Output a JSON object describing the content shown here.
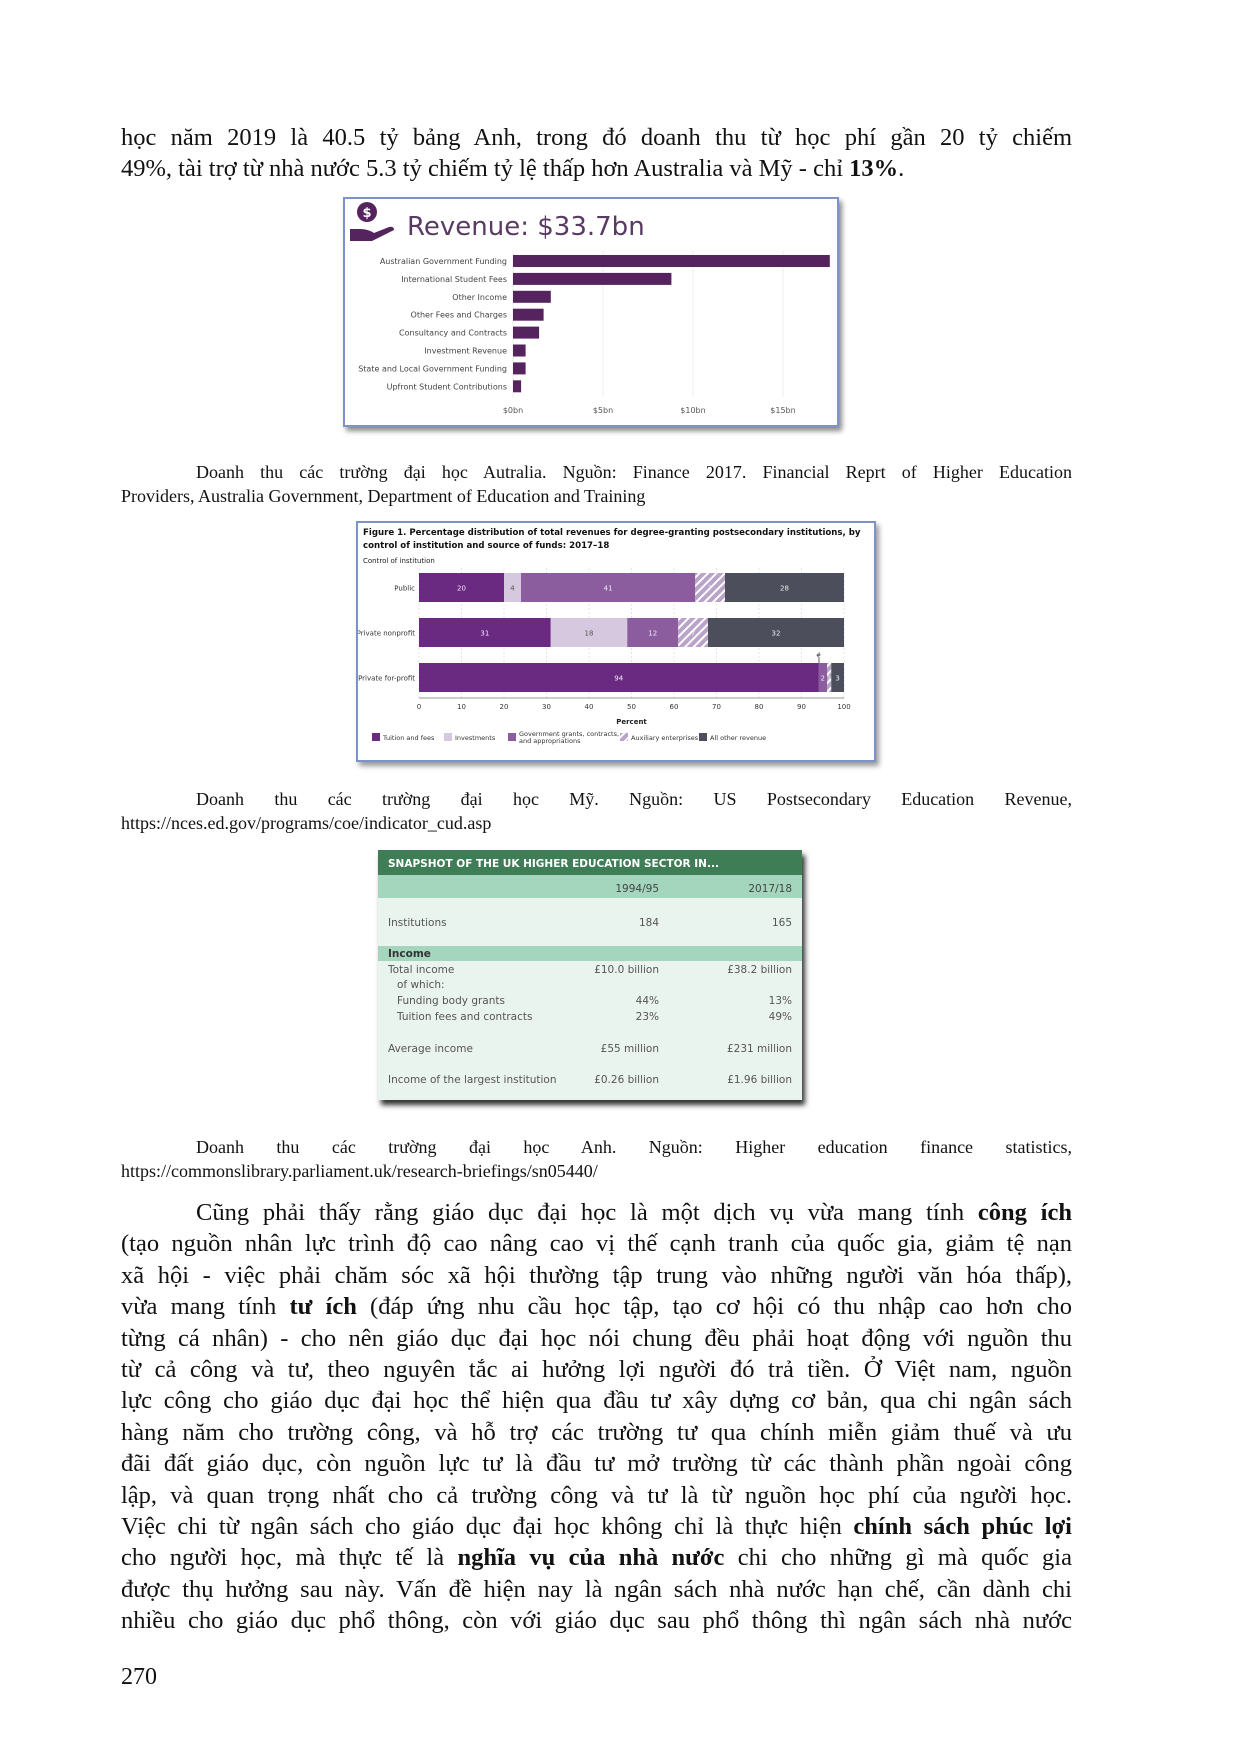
{
  "top_lines": [
    [
      {
        "t": "học năm 2019 là 40.5 tỷ bảng Anh, trong đó doanh thu từ học phí gần 20 tỷ chiếm"
      }
    ],
    [
      {
        "t": "49%, tài trợ từ nhà nước 5.3 tỷ chiếm tỷ lệ thấp hơn Australia và Mỹ - chỉ "
      },
      {
        "t": "13%",
        "b": true
      },
      {
        "t": "."
      }
    ]
  ],
  "figure1": {
    "icon": "hand-dollar-icon",
    "accent": "#55245e",
    "chart_data": {
      "type": "bar",
      "orientation": "horizontal",
      "title": "Revenue: $33.7bn",
      "categories": [
        "Australian Government Funding",
        "International Student Fees",
        "Other Income",
        "Other Fees and Charges",
        "Consultancy and Contracts",
        "Investment Revenue",
        "State and Local Government Funding",
        "Upfront Student Contributions"
      ],
      "values": [
        17.6,
        8.8,
        2.1,
        1.7,
        1.45,
        0.7,
        0.7,
        0.45
      ],
      "unit": "$bn",
      "xticks": [
        "$0bn",
        "$5bn",
        "$10bn",
        "$15bn"
      ],
      "xtick_values": [
        0,
        5,
        10,
        15
      ],
      "xlim": [
        0,
        17.8
      ],
      "grid": true
    }
  },
  "caption1": [
    "Doanh thu các trường đại học Autralia. Nguồn: Finance 2017. Financial Reprt of Higher Education",
    "Providers, Australia Government, Department of Education and Training"
  ],
  "figure2": {
    "chart_data": {
      "type": "bar",
      "stacked": true,
      "orientation": "horizontal",
      "title": "Figure 1. Percentage distribution of total revenues for degree-granting postsecondary institutions, by control of institution and source of funds: 2017–18",
      "title_lines": [
        "Figure 1. Percentage distribution of total revenues for degree-granting postsecondary institutions, by",
        "control of institution and source of funds: 2017–18"
      ],
      "ylabel": "Control of institution",
      "xlabel": "Percent",
      "categories": [
        "Public",
        "Private nonprofit",
        "Private for-profit"
      ],
      "series": [
        {
          "name": "Tuition and fees",
          "color": "#6a2a82",
          "values": [
            20,
            31,
            94
          ],
          "labels": [
            "20",
            "31",
            "94"
          ]
        },
        {
          "name": "Investments",
          "color": "#d5c8df",
          "values": [
            4,
            18,
            0
          ],
          "labels": [
            "4",
            "18",
            "#"
          ]
        },
        {
          "name": "Government grants, contracts, and appropriations",
          "color": "#8b5c9e",
          "values": [
            41,
            12,
            2
          ],
          "labels": [
            "41",
            "12",
            "2"
          ]
        },
        {
          "name": "Auxiliary enterprises",
          "color": "#b9a3c9",
          "hatched": true,
          "values": [
            7,
            7,
            1
          ],
          "labels": [
            "7",
            "7",
            "1"
          ]
        },
        {
          "name": "All other revenue",
          "color": "#4d4e5c",
          "values": [
            28,
            32,
            3
          ],
          "labels": [
            "28",
            "32",
            "3"
          ]
        }
      ],
      "legend": [
        "Tuition and fees",
        "Investments",
        "Government grants, contracts,|and appropriations",
        "Auxiliary enterprises",
        "All other revenue"
      ],
      "xticks": [
        "0",
        "10",
        "20",
        "30",
        "40",
        "50",
        "60",
        "70",
        "80",
        "90",
        "100"
      ],
      "xlim": [
        0,
        100
      ],
      "grid": true,
      "legend_placement": "bottom"
    }
  },
  "caption2": [
    "Doanh thu các trường đại học Mỹ. Nguồn: US Postsecondary Education Revenue,",
    "https://nces.ed.gov/programs/coe/indicator_cud.asp"
  ],
  "table": {
    "title": "SNAPSHOT OF THE UK HIGHER EDUCATION SECTOR IN...",
    "header_color": "#3f7d57",
    "subheader_color": "#a3d6bd",
    "columns": [
      "1994/95",
      "2017/18"
    ],
    "section": "Income",
    "rows": [
      {
        "label": "Institutions",
        "v1": "184",
        "v2": "165"
      },
      {
        "label": "Total income",
        "v1": "£10.0 billion",
        "v2": "£38.2 billion"
      },
      {
        "label": "of which:",
        "v1": "",
        "v2": ""
      },
      {
        "label": "Funding body grants",
        "v1": "44%",
        "v2": "13%"
      },
      {
        "label": "Tuition fees and contracts",
        "v1": "23%",
        "v2": "49%"
      },
      {
        "label": "Average income",
        "v1": "£55 million",
        "v2": "£231 million"
      },
      {
        "label": "Income of the largest institution",
        "v1": "£0.26 billion",
        "v2": "£1.96 billion"
      }
    ]
  },
  "caption3": [
    "Doanh thu các trường đại học Anh. Nguồn: Higher education finance statistics,",
    "https://commonslibrary.parliament.uk/research-briefings/sn05440/"
  ],
  "body_lines": [
    [
      {
        "t": "Cũng phải thấy rằng giáo dục đại học là một dịch vụ vừa mang tính "
      },
      {
        "t": "công ích",
        "b": true
      }
    ],
    [
      {
        "t": "(tạo nguồn nhân lực trình độ cao nâng cao vị thế cạnh tranh của quốc gia, giảm tệ nạn"
      }
    ],
    [
      {
        "t": "xã hội - việc phải chăm sóc xã hội thường tập trung vào những người văn hóa thấp),"
      }
    ],
    [
      {
        "t": "vừa mang tính "
      },
      {
        "t": "tư ích",
        "b": true
      },
      {
        "t": " (đáp ứng nhu cầu học tập, tạo cơ hội có thu nhập cao hơn cho"
      }
    ],
    [
      {
        "t": "từng cá nhân) - cho nên giáo dục đại học nói chung đều phải hoạt động với nguồn thu"
      }
    ],
    [
      {
        "t": "từ cả công và tư, theo nguyên tắc ai hưởng lợi người đó trả tiền. Ở Việt nam, nguồn"
      }
    ],
    [
      {
        "t": "lực công cho giáo dục đại học thể hiện qua đầu tư xây dựng cơ bản, qua chi ngân sách"
      }
    ],
    [
      {
        "t": "hàng năm cho trường công, và hỗ trợ các trường tư qua chính miễn giảm thuế và ưu"
      }
    ],
    [
      {
        "t": "đãi đất giáo dục, còn nguồn lực tư là đầu tư mở trường từ các thành phần ngoài công"
      }
    ],
    [
      {
        "t": "lập, và quan trọng nhất cho cả trường công và tư là từ nguồn học phí của người học."
      }
    ],
    [
      {
        "t": "Việc chi từ ngân sách cho giáo dục đại học không chỉ là thực hiện "
      },
      {
        "t": "chính sách phúc lợi",
        "b": true
      }
    ],
    [
      {
        "t": "cho người học, mà thực tế là "
      },
      {
        "t": "nghĩa vụ của nhà nước",
        "b": true
      },
      {
        "t": " chi cho những gì mà quốc gia"
      }
    ],
    [
      {
        "t": "được thụ hưởng sau này. Vấn đề hiện nay là ngân sách nhà nước hạn chế, cần dành chi"
      }
    ],
    [
      {
        "t": "nhiều cho giáo dục phổ thông, còn với giáo dục sau phổ thông thì ngân sách nhà nước"
      }
    ]
  ],
  "page_number": "270"
}
